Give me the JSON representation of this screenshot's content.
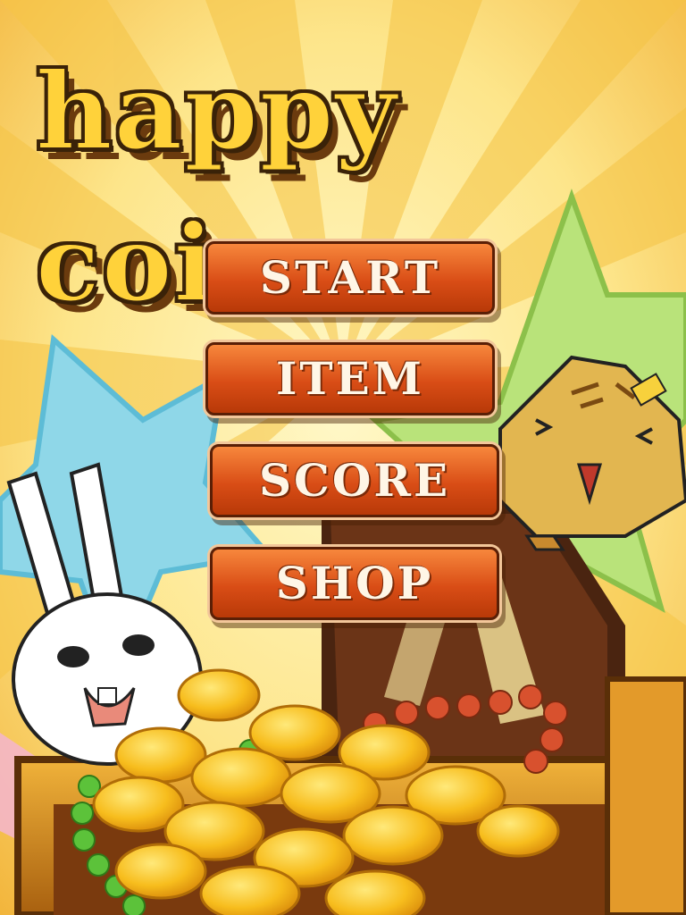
{
  "game": {
    "title": "happy coin"
  },
  "menu": {
    "start_label": "START",
    "item_label": "ITEM",
    "score_label": "SCORE",
    "shop_label": "SHOP"
  },
  "colors": {
    "title_fill": "#ffd23a",
    "title_outline": "#3a2208",
    "button_top": "#f7873c",
    "button_bottom": "#b83908",
    "button_text": "#fff6e6",
    "coin": "#f5b81c",
    "bead_red": "#d8512e",
    "bead_green": "#5cc23a"
  }
}
